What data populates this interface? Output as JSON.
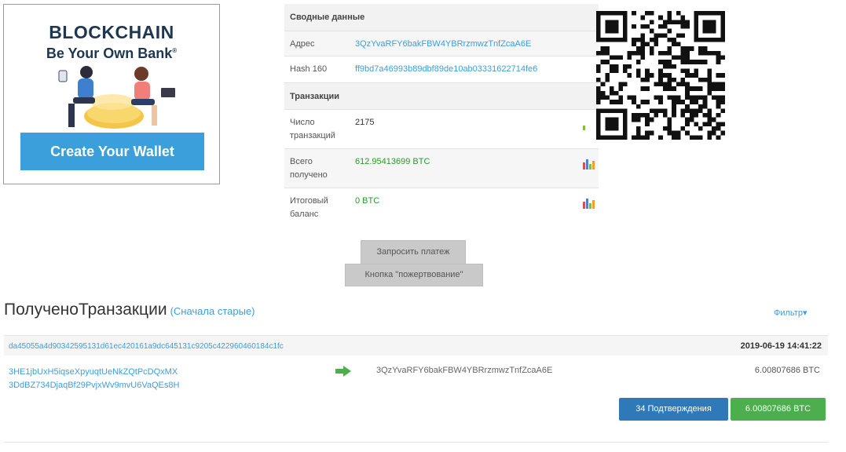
{
  "ad": {
    "title": "BLOCKCHAIN",
    "subtitle": "Be Your Own Bank",
    "subtitle_mark": "®",
    "cta": "Create Your Wallet"
  },
  "summary": {
    "header": "Сводные данные",
    "address_label": "Адрес",
    "address_value": "3QzYvaRFY6bakFBW4YBRrzmwzTnfZcaA6E",
    "hash160_label": "Hash 160",
    "hash160_value": "ff9bd7a46993b89dbf89de10ab03331622714fe6",
    "transactions_header": "Транзакции",
    "tx_count_label_1": "Число",
    "tx_count_label_2": "транзакций",
    "tx_count_value": "2175",
    "received_label_1": "Всего",
    "received_label_2": "получено",
    "received_value": "612.95413699 BTC",
    "balance_label_1": "Итоговый",
    "balance_label_2": "баланс",
    "balance_value": "0 BTC"
  },
  "buttons": {
    "request_payment": "Запросить платеж",
    "donate_button": "Кнопка \"пожертвование\""
  },
  "transactions": {
    "title": "ПолученоТранзакции",
    "sort_link": "(Сначала старые)",
    "filter": "Фильтр▾",
    "items": [
      {
        "hash": "da45055a4d90342595131d61ec420161a9dc645131c9205c422960460184c1fc",
        "time": "2019-06-19 14:41:22",
        "from_1": "3HE1jbUxH5iqseXpyuqtUeNkZQtPcDQxMX",
        "from_2": "3DdBZ734DjaqBf29PvjxWv9mvU6VaQEs8H",
        "to": "3QzYvaRFY6bakFBW4YBRrzmwzTnfZcaA6E",
        "amount": "6.00807686 BTC",
        "confirmations": "34 Подтверждения",
        "total": "6.00807686 BTC"
      }
    ]
  },
  "colors": {
    "link": "#3f9ddc",
    "green": "#2a9a2a",
    "confirm_btn": "#2f79b9",
    "amount_btn": "#4cae4c",
    "ad_button": "#3b9fdc"
  }
}
